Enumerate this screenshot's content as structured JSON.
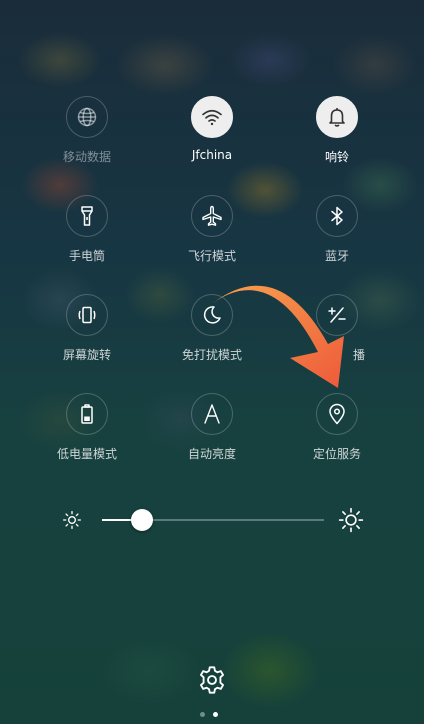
{
  "toggles": [
    {
      "label": "移动数据",
      "icon": "globe-icon",
      "state": "disabled"
    },
    {
      "label": "Jfchina",
      "icon": "wifi-icon",
      "state": "on"
    },
    {
      "label": "响铃",
      "icon": "bell-icon",
      "state": "on"
    },
    {
      "label": "手电筒",
      "icon": "flashlight-icon",
      "state": "off"
    },
    {
      "label": "飞行模式",
      "icon": "airplane-icon",
      "state": "off"
    },
    {
      "label": "蓝牙",
      "icon": "bluetooth-icon",
      "state": "off"
    },
    {
      "label": "屏幕旋转",
      "icon": "rotate-icon",
      "state": "off"
    },
    {
      "label": "免打扰模式",
      "icon": "moon-icon",
      "state": "off"
    },
    {
      "label": "播",
      "icon": "plus-minus-icon",
      "state": "off"
    },
    {
      "label": "低电量模式",
      "icon": "battery-icon",
      "state": "off"
    },
    {
      "label": "自动亮度",
      "icon": "auto-brightness-icon",
      "state": "off"
    },
    {
      "label": "定位服务",
      "icon": "location-pin-icon",
      "state": "off"
    }
  ],
  "brightness": {
    "level": 0.18
  },
  "page_indicator": {
    "count": 2,
    "active_index": 1
  },
  "colors": {
    "arrow_start": "#f7a24e",
    "arrow_end": "#ee5a3a",
    "toggle_on_bg": "#eeeeee",
    "toggle_on_icon": "#333333",
    "icon_off": "#ffffff"
  }
}
